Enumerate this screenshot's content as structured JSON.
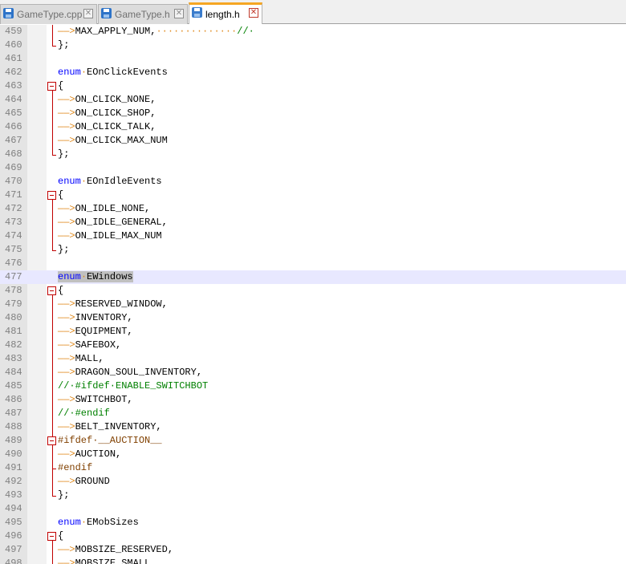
{
  "tabs": [
    {
      "label": "GameType.cpp",
      "active": false
    },
    {
      "label": "GameType.h",
      "active": false
    },
    {
      "label": "length.h",
      "active": true
    }
  ],
  "editor": {
    "lines": [
      {
        "num": "459",
        "segs": [
          {
            "t": "——>",
            "c": "arrow"
          },
          {
            "t": "MAX_APPLY_NUM,",
            "c": ""
          },
          {
            "t": "··············",
            "c": "ws"
          },
          {
            "t": "//·",
            "c": "cm"
          }
        ]
      },
      {
        "num": "460",
        "segs": [
          {
            "t": "};",
            "c": ""
          }
        ]
      },
      {
        "num": "461",
        "segs": []
      },
      {
        "num": "462",
        "segs": [
          {
            "t": "enum",
            "c": "kw"
          },
          {
            "t": "·",
            "c": "ws"
          },
          {
            "t": "EOnClickEvents",
            "c": ""
          }
        ]
      },
      {
        "num": "463",
        "segs": [
          {
            "t": "{",
            "c": ""
          }
        ]
      },
      {
        "num": "464",
        "segs": [
          {
            "t": "——>",
            "c": "arrow"
          },
          {
            "t": "ON_CLICK_NONE,",
            "c": ""
          }
        ]
      },
      {
        "num": "465",
        "segs": [
          {
            "t": "——>",
            "c": "arrow"
          },
          {
            "t": "ON_CLICK_SHOP,",
            "c": ""
          }
        ]
      },
      {
        "num": "466",
        "segs": [
          {
            "t": "——>",
            "c": "arrow"
          },
          {
            "t": "ON_CLICK_TALK,",
            "c": ""
          }
        ]
      },
      {
        "num": "467",
        "segs": [
          {
            "t": "——>",
            "c": "arrow"
          },
          {
            "t": "ON_CLICK_MAX_NUM",
            "c": ""
          }
        ]
      },
      {
        "num": "468",
        "segs": [
          {
            "t": "};",
            "c": ""
          }
        ]
      },
      {
        "num": "469",
        "segs": []
      },
      {
        "num": "470",
        "segs": [
          {
            "t": "enum",
            "c": "kw"
          },
          {
            "t": "·",
            "c": "ws"
          },
          {
            "t": "EOnIdleEvents",
            "c": ""
          }
        ]
      },
      {
        "num": "471",
        "segs": [
          {
            "t": "{",
            "c": ""
          }
        ]
      },
      {
        "num": "472",
        "segs": [
          {
            "t": "——>",
            "c": "arrow"
          },
          {
            "t": "ON_IDLE_NONE,",
            "c": ""
          }
        ]
      },
      {
        "num": "473",
        "segs": [
          {
            "t": "——>",
            "c": "arrow"
          },
          {
            "t": "ON_IDLE_GENERAL,",
            "c": ""
          }
        ]
      },
      {
        "num": "474",
        "segs": [
          {
            "t": "——>",
            "c": "arrow"
          },
          {
            "t": "ON_IDLE_MAX_NUM",
            "c": ""
          }
        ]
      },
      {
        "num": "475",
        "segs": [
          {
            "t": "};",
            "c": ""
          }
        ]
      },
      {
        "num": "476",
        "segs": []
      },
      {
        "num": "477",
        "segs": [
          {
            "t": "enum",
            "c": "kw sel"
          },
          {
            "t": "·",
            "c": "ws sel"
          },
          {
            "t": "EWindows",
            "c": "sel"
          }
        ],
        "highlight": true
      },
      {
        "num": "478",
        "segs": [
          {
            "t": "{",
            "c": ""
          }
        ]
      },
      {
        "num": "479",
        "segs": [
          {
            "t": "——>",
            "c": "arrow"
          },
          {
            "t": "RESERVED_WINDOW,",
            "c": ""
          }
        ]
      },
      {
        "num": "480",
        "segs": [
          {
            "t": "——>",
            "c": "arrow"
          },
          {
            "t": "INVENTORY,",
            "c": ""
          }
        ]
      },
      {
        "num": "481",
        "segs": [
          {
            "t": "——>",
            "c": "arrow"
          },
          {
            "t": "EQUIPMENT,",
            "c": ""
          }
        ]
      },
      {
        "num": "482",
        "segs": [
          {
            "t": "——>",
            "c": "arrow"
          },
          {
            "t": "SAFEBOX,",
            "c": ""
          }
        ]
      },
      {
        "num": "483",
        "segs": [
          {
            "t": "——>",
            "c": "arrow"
          },
          {
            "t": "MALL,",
            "c": ""
          }
        ]
      },
      {
        "num": "484",
        "segs": [
          {
            "t": "——>",
            "c": "arrow"
          },
          {
            "t": "DRAGON_SOUL_INVENTORY,",
            "c": ""
          }
        ]
      },
      {
        "num": "485",
        "segs": [
          {
            "t": "//·#ifdef·ENABLE_SWITCHBOT",
            "c": "cm"
          }
        ]
      },
      {
        "num": "486",
        "segs": [
          {
            "t": "——>",
            "c": "arrow"
          },
          {
            "t": "SWITCHBOT,",
            "c": ""
          }
        ]
      },
      {
        "num": "487",
        "segs": [
          {
            "t": "//·#endif",
            "c": "cm"
          }
        ]
      },
      {
        "num": "488",
        "segs": [
          {
            "t": "——>",
            "c": "arrow"
          },
          {
            "t": "BELT_INVENTORY,",
            "c": ""
          }
        ]
      },
      {
        "num": "489",
        "segs": [
          {
            "t": "#ifdef·__AUCTION__",
            "c": "pp"
          }
        ]
      },
      {
        "num": "490",
        "segs": [
          {
            "t": "——>",
            "c": "arrow"
          },
          {
            "t": "AUCTION,",
            "c": ""
          }
        ]
      },
      {
        "num": "491",
        "segs": [
          {
            "t": "#endif",
            "c": "pp"
          }
        ]
      },
      {
        "num": "492",
        "segs": [
          {
            "t": "——>",
            "c": "arrow"
          },
          {
            "t": "GROUND",
            "c": ""
          }
        ]
      },
      {
        "num": "493",
        "segs": [
          {
            "t": "};",
            "c": ""
          }
        ]
      },
      {
        "num": "494",
        "segs": []
      },
      {
        "num": "495",
        "segs": [
          {
            "t": "enum",
            "c": "kw"
          },
          {
            "t": "·",
            "c": "ws"
          },
          {
            "t": "EMobSizes",
            "c": ""
          }
        ]
      },
      {
        "num": "496",
        "segs": [
          {
            "t": "{",
            "c": ""
          }
        ]
      },
      {
        "num": "497",
        "segs": [
          {
            "t": "——>",
            "c": "arrow"
          },
          {
            "t": "MOBSIZE_RESERVED,",
            "c": ""
          }
        ]
      },
      {
        "num": "498",
        "segs": [
          {
            "t": "——>",
            "c": "arrow"
          },
          {
            "t": "MOBSIZE_SMALL,",
            "c": ""
          }
        ]
      }
    ]
  }
}
